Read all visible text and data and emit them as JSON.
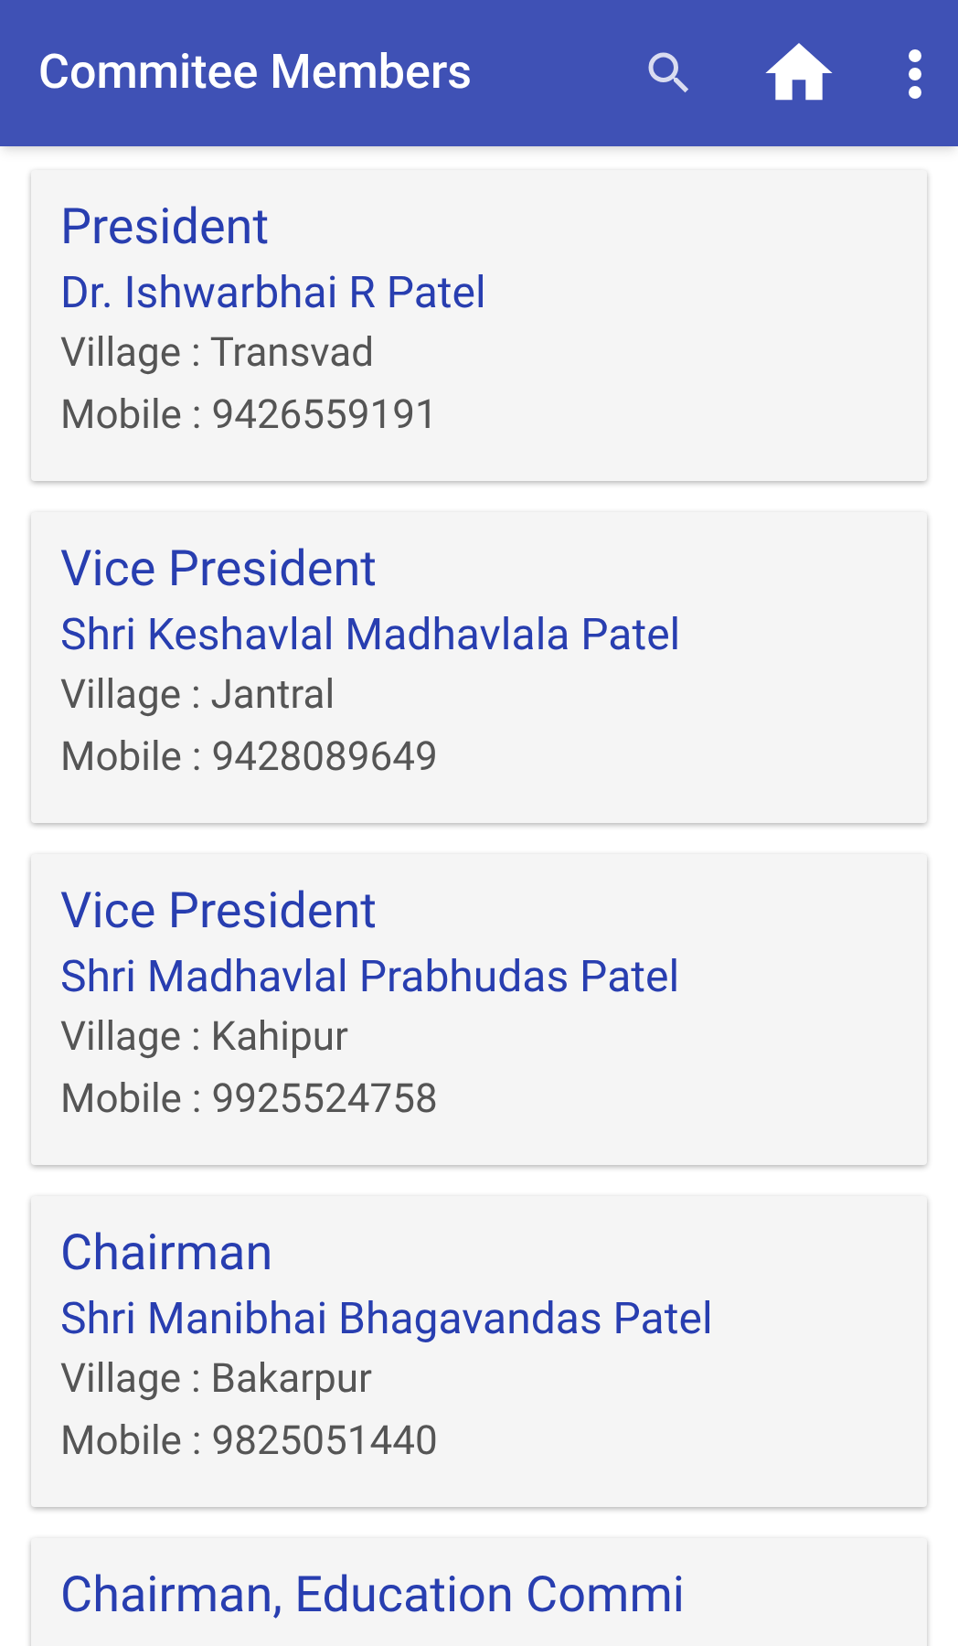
{
  "app_bar": {
    "title": "Commitee Members"
  },
  "members": [
    {
      "role": "President",
      "name": "Dr. Ishwarbhai R Patel",
      "village": "Village : Transvad",
      "mobile": "Mobile : 9426559191"
    },
    {
      "role": "Vice President",
      "name": "Shri Keshavlal Madhavlala Patel",
      "village": "Village : Jantral",
      "mobile": "Mobile : 9428089649"
    },
    {
      "role": "Vice President",
      "name": "Shri Madhavlal Prabhudas Patel",
      "village": "Village : Kahipur",
      "mobile": "Mobile : 9925524758"
    },
    {
      "role": "Chairman",
      "name": "Shri Manibhai Bhagavandas Patel",
      "village": "Village : Bakarpur",
      "mobile": "Mobile : 9825051440"
    },
    {
      "role": "Chairman, Education Commi"
    }
  ]
}
